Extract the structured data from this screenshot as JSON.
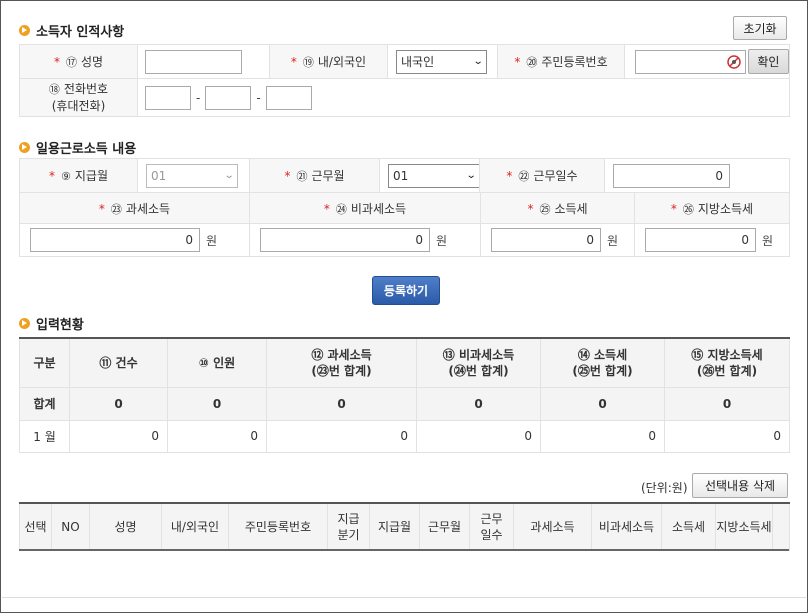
{
  "section1": {
    "title": "소득자 인적사항",
    "reset_button": "초기화",
    "name_label_num": "⑰",
    "name_label": "성명",
    "name_value": "",
    "nationality_label_num": "⑲",
    "nationality_label": "내/외국인",
    "nationality_value": "내국인",
    "rrn_label_num": "⑳",
    "rrn_label": "주민등록번호",
    "rrn_value": "",
    "confirm_button": "확인",
    "phone_label_num": "⑱",
    "phone_label_line1": "전화번호",
    "phone_label_line2": "(휴대전화)",
    "phone_dash": "-"
  },
  "section2": {
    "title": "일용근로소득 내용",
    "pay_month_num": "⑨",
    "pay_month_label": "지급월",
    "pay_month_value": "01",
    "work_month_num": "㉑",
    "work_month_label": "근무월",
    "work_month_value": "01",
    "work_days_num": "㉒",
    "work_days_label": "근무일수",
    "work_days_value": "0",
    "taxable_num": "㉓",
    "taxable_label": "과세소득",
    "taxable_value": "0",
    "nontaxable_num": "㉔",
    "nontaxable_label": "비과세소득",
    "nontaxable_value": "0",
    "income_tax_num": "㉕",
    "income_tax_label": "소득세",
    "income_tax_value": "0",
    "local_tax_num": "㉖",
    "local_tax_label": "지방소득세",
    "local_tax_value": "0",
    "unit_won": "원",
    "register_button": "등록하기"
  },
  "section3": {
    "title": "입력현황",
    "headers": [
      {
        "l1": "구분",
        "l2": ""
      },
      {
        "l1": "⑪ 건수",
        "l2": ""
      },
      {
        "l1": "⑩ 인원",
        "l2": ""
      },
      {
        "l1": "⑫ 과세소득",
        "l2": "(㉓번 합계)"
      },
      {
        "l1": "⑬ 비과세소득",
        "l2": "(㉔번 합계)"
      },
      {
        "l1": "⑭ 소득세",
        "l2": "(㉕번 합계)"
      },
      {
        "l1": "⑮ 지방소득세",
        "l2": "(㉖번 합계)"
      }
    ],
    "total_row": [
      "합계",
      "0",
      "0",
      "0",
      "0",
      "0",
      "0"
    ],
    "month_row": [
      "1 월",
      "0",
      "0",
      "0",
      "0",
      "0",
      "0"
    ]
  },
  "section4": {
    "unit_label": "(단위:원)",
    "delete_button": "선택내용 삭제",
    "headers": [
      {
        "l1": "선택",
        "l2": ""
      },
      {
        "l1": "NO",
        "l2": ""
      },
      {
        "l1": "성명",
        "l2": ""
      },
      {
        "l1": "내/외국인",
        "l2": ""
      },
      {
        "l1": "주민등록번호",
        "l2": ""
      },
      {
        "l1": "지급",
        "l2": "분기"
      },
      {
        "l1": "지급월",
        "l2": ""
      },
      {
        "l1": "근무월",
        "l2": ""
      },
      {
        "l1": "근무",
        "l2": "일수"
      },
      {
        "l1": "과세소득",
        "l2": ""
      },
      {
        "l1": "비과세소득",
        "l2": ""
      },
      {
        "l1": "소득세",
        "l2": ""
      },
      {
        "l1": "지방소득세",
        "l2": ""
      }
    ]
  }
}
